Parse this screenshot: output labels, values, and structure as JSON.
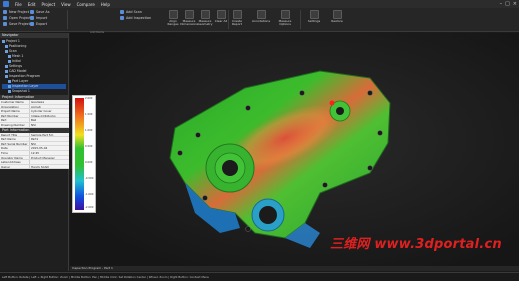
{
  "menubar": {
    "items": [
      "File",
      "Edit",
      "Project",
      "View",
      "Compare",
      "Help"
    ]
  },
  "ribbon": {
    "small_actions": [
      "New Project",
      "Open Project",
      "Save Project",
      "Save As",
      "Import",
      "Export",
      "Add Scan",
      "Add Inspection"
    ],
    "big_buttons": [
      {
        "label": "Align Ranges",
        "icon": "align-icon"
      },
      {
        "label": "Measure Dimensions",
        "icon": "measure-icon"
      },
      {
        "label": "Measure Geometry",
        "icon": "geometry-icon"
      },
      {
        "label": "Clear All",
        "icon": "clear-icon"
      },
      {
        "label": "Create Report",
        "icon": "report-icon"
      },
      {
        "label": "Annotations",
        "icon": "annotation-icon"
      },
      {
        "label": "Measure Options",
        "icon": "options-icon"
      },
      {
        "label": "Settings",
        "icon": "settings-icon"
      },
      {
        "label": "Restore",
        "icon": "restore-icon"
      }
    ],
    "group_label": "Add Items"
  },
  "navigator": {
    "title": "Navigator",
    "items": [
      {
        "label": "Project 1",
        "selected": false
      },
      {
        "label": "Positioning",
        "selected": false
      },
      {
        "label": "Scan",
        "selected": false
      },
      {
        "label": "Mesh 1",
        "selected": false
      },
      {
        "label": "Initial",
        "selected": false
      },
      {
        "label": "Settings",
        "selected": false
      },
      {
        "label": "CAD Model",
        "selected": false
      },
      {
        "label": "Inspection Program",
        "selected": false
      },
      {
        "label": "Part Layer",
        "selected": false
      },
      {
        "label": "Inspection Layer",
        "selected": true
      },
      {
        "label": "Snapshot 1",
        "selected": false
      }
    ]
  },
  "project_info": {
    "title": "Project Information",
    "rows": [
      {
        "k": "Customer Name",
        "v": "Geodesia"
      },
      {
        "k": "Organization",
        "v": "Acmeti"
      },
      {
        "k": "Project Name",
        "v": "Cylinder Cover"
      },
      {
        "k": "Part Number",
        "v": "Intake-CCR-Rocks"
      },
      {
        "k": "Part",
        "v": "Ball"
      },
      {
        "k": "Drawing Number",
        "v": "NSI"
      }
    ]
  },
  "part_info": {
    "title": "Part Information",
    "rows": [
      {
        "k": "Report Title",
        "v": "Sample Part 5m"
      },
      {
        "k": "Part Name",
        "v": "Part1"
      },
      {
        "k": "Part Serial Number",
        "v": "NSI"
      },
      {
        "k": "Date",
        "v": "2015-05-04"
      },
      {
        "k": "Time",
        "v": "12:45"
      },
      {
        "k": "Operator Name",
        "v": "Product Manager"
      },
      {
        "k": "Label Address",
        "v": ""
      },
      {
        "k": "Owner",
        "v": "Handy SCAN"
      }
    ]
  },
  "colorbar": {
    "labels": [
      "2.000",
      "1.500",
      "1.000",
      "0.500",
      "0.000",
      "-0.500",
      "-1.000",
      "-2.000"
    ]
  },
  "inspection_bar": "Inspection Program - Part 1",
  "status_bar": "Left Button: Rotate | Left + Right Button: Zoom | Middle Button: Pan | Middle Click: Set Rotation Center | Wheel: Zoom | Right Button: Context Menu",
  "watermark": "三维网 www.3dportal.cn"
}
